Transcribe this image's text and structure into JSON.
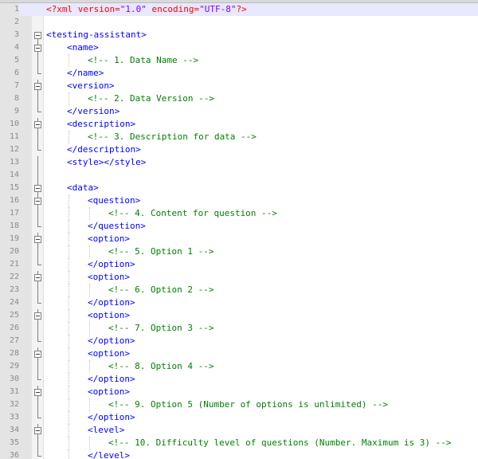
{
  "lines": [
    {
      "num": "1",
      "indent": 0,
      "parts": [
        {
          "t": "<?xml ",
          "c": "pi"
        },
        {
          "t": "version=",
          "c": "attr"
        },
        {
          "t": "\"1.0\"",
          "c": "attrval"
        },
        {
          "t": " encoding=",
          "c": "attr"
        },
        {
          "t": "\"UTF-8\"",
          "c": "attrval"
        },
        {
          "t": "?>",
          "c": "pi"
        }
      ],
      "fold": "none",
      "current": true
    },
    {
      "num": "2",
      "indent": 0,
      "parts": [],
      "fold": "none"
    },
    {
      "num": "3",
      "indent": 0,
      "parts": [
        {
          "t": "<testing-assistant>",
          "c": "tag"
        }
      ],
      "fold": "open-root"
    },
    {
      "num": "4",
      "indent": 1,
      "parts": [
        {
          "t": "<name>",
          "c": "tag"
        }
      ],
      "fold": "open"
    },
    {
      "num": "5",
      "indent": 2,
      "parts": [
        {
          "t": "<!-- 1. Data Name -->",
          "c": "comment"
        }
      ],
      "fold": "line"
    },
    {
      "num": "6",
      "indent": 1,
      "parts": [
        {
          "t": "</name>",
          "c": "tag"
        }
      ],
      "fold": "end"
    },
    {
      "num": "7",
      "indent": 1,
      "parts": [
        {
          "t": "<version>",
          "c": "tag"
        }
      ],
      "fold": "open"
    },
    {
      "num": "8",
      "indent": 2,
      "parts": [
        {
          "t": "<!-- 2. Data Version -->",
          "c": "comment"
        }
      ],
      "fold": "line"
    },
    {
      "num": "9",
      "indent": 1,
      "parts": [
        {
          "t": "</version>",
          "c": "tag"
        }
      ],
      "fold": "end"
    },
    {
      "num": "10",
      "indent": 1,
      "parts": [
        {
          "t": "<description>",
          "c": "tag"
        }
      ],
      "fold": "open"
    },
    {
      "num": "11",
      "indent": 2,
      "parts": [
        {
          "t": "<!-- 3. Description for data -->",
          "c": "comment"
        }
      ],
      "fold": "line"
    },
    {
      "num": "12",
      "indent": 1,
      "parts": [
        {
          "t": "</description>",
          "c": "tag"
        }
      ],
      "fold": "end"
    },
    {
      "num": "13",
      "indent": 1,
      "parts": [
        {
          "t": "<style></style>",
          "c": "tag"
        }
      ],
      "fold": "line"
    },
    {
      "num": "14",
      "indent": 0,
      "parts": [],
      "fold": "line"
    },
    {
      "num": "15",
      "indent": 1,
      "parts": [
        {
          "t": "<data>",
          "c": "tag"
        }
      ],
      "fold": "open"
    },
    {
      "num": "16",
      "indent": 2,
      "parts": [
        {
          "t": "<question>",
          "c": "tag"
        }
      ],
      "fold": "open"
    },
    {
      "num": "17",
      "indent": 3,
      "parts": [
        {
          "t": "<!-- 4. Content for question -->",
          "c": "comment"
        }
      ],
      "fold": "line"
    },
    {
      "num": "18",
      "indent": 2,
      "parts": [
        {
          "t": "</question>",
          "c": "tag"
        }
      ],
      "fold": "end"
    },
    {
      "num": "19",
      "indent": 2,
      "parts": [
        {
          "t": "<option>",
          "c": "tag"
        }
      ],
      "fold": "open"
    },
    {
      "num": "20",
      "indent": 3,
      "parts": [
        {
          "t": "<!-- 5. Option 1 -->",
          "c": "comment"
        }
      ],
      "fold": "line"
    },
    {
      "num": "21",
      "indent": 2,
      "parts": [
        {
          "t": "</option>",
          "c": "tag"
        }
      ],
      "fold": "end"
    },
    {
      "num": "22",
      "indent": 2,
      "parts": [
        {
          "t": "<option>",
          "c": "tag"
        }
      ],
      "fold": "open"
    },
    {
      "num": "23",
      "indent": 3,
      "parts": [
        {
          "t": "<!-- 6. Option 2 -->",
          "c": "comment"
        }
      ],
      "fold": "line"
    },
    {
      "num": "24",
      "indent": 2,
      "parts": [
        {
          "t": "</option>",
          "c": "tag"
        }
      ],
      "fold": "end"
    },
    {
      "num": "25",
      "indent": 2,
      "parts": [
        {
          "t": "<option>",
          "c": "tag"
        }
      ],
      "fold": "open"
    },
    {
      "num": "26",
      "indent": 3,
      "parts": [
        {
          "t": "<!-- 7. Option 3 -->",
          "c": "comment"
        }
      ],
      "fold": "line"
    },
    {
      "num": "27",
      "indent": 2,
      "parts": [
        {
          "t": "</option>",
          "c": "tag"
        }
      ],
      "fold": "end"
    },
    {
      "num": "28",
      "indent": 2,
      "parts": [
        {
          "t": "<option>",
          "c": "tag"
        }
      ],
      "fold": "open"
    },
    {
      "num": "29",
      "indent": 3,
      "parts": [
        {
          "t": "<!-- 8. Option 4 -->",
          "c": "comment"
        }
      ],
      "fold": "line"
    },
    {
      "num": "30",
      "indent": 2,
      "parts": [
        {
          "t": "</option>",
          "c": "tag"
        }
      ],
      "fold": "end"
    },
    {
      "num": "31",
      "indent": 2,
      "parts": [
        {
          "t": "<option>",
          "c": "tag"
        }
      ],
      "fold": "open"
    },
    {
      "num": "32",
      "indent": 3,
      "parts": [
        {
          "t": "<!-- 9. Option 5 (Number of options is unlimited) -->",
          "c": "comment"
        }
      ],
      "fold": "line"
    },
    {
      "num": "33",
      "indent": 2,
      "parts": [
        {
          "t": "</option>",
          "c": "tag"
        }
      ],
      "fold": "end"
    },
    {
      "num": "34",
      "indent": 2,
      "parts": [
        {
          "t": "<level>",
          "c": "tag"
        }
      ],
      "fold": "open"
    },
    {
      "num": "35",
      "indent": 3,
      "parts": [
        {
          "t": "<!-- 10. Difficulty level of questions (Number. Maximum is 3) -->",
          "c": "comment"
        }
      ],
      "fold": "line"
    },
    {
      "num": "36",
      "indent": 2,
      "parts": [
        {
          "t": "</level>",
          "c": "tag"
        }
      ],
      "fold": "end"
    }
  ],
  "colors": {
    "tag": "#0000ff",
    "comment": "#008000",
    "pi": "#ff0000",
    "attr": "#ff0000",
    "attrval": "#8000ff",
    "current_line_bg": "#e8e8ff",
    "gutter_bg": "#e4e4e4"
  },
  "icons": {
    "fold_open": "minus-box-icon",
    "fold_line": "fold-line",
    "fold_end": "fold-end-tick"
  }
}
